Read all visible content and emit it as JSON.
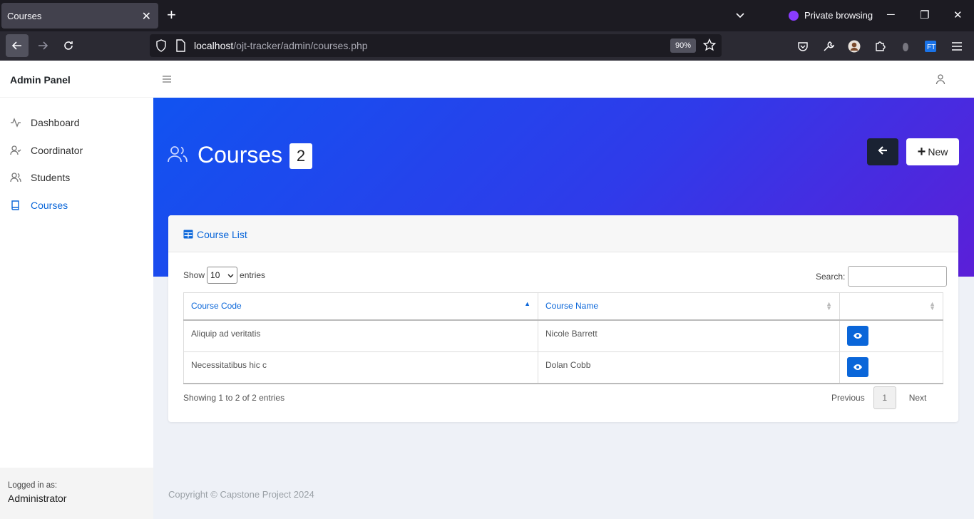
{
  "browser": {
    "tab_title": "Courses",
    "private_label": "Private browsing",
    "url_host": "localhost",
    "url_path": "/ojt-tracker/admin/courses.php",
    "zoom": "90%"
  },
  "sidebar": {
    "brand": "Admin Panel",
    "items": [
      {
        "label": "Dashboard",
        "icon": "activity-icon"
      },
      {
        "label": "Coordinator",
        "icon": "user-check-icon"
      },
      {
        "label": "Students",
        "icon": "users-icon"
      },
      {
        "label": "Courses",
        "icon": "book-icon",
        "active": true
      }
    ],
    "footer": {
      "logged_in_label": "Logged in as:",
      "user": "Administrator"
    }
  },
  "header": {
    "title": "Courses",
    "count": "2",
    "new_label": "New"
  },
  "card": {
    "title": "Course List",
    "show_label": "Show",
    "entries_value": "10",
    "entries_label": "entries",
    "search_label": "Search:",
    "columns": [
      "Course Code",
      "Course Name",
      ""
    ],
    "rows": [
      {
        "code": "Aliquip ad veritatis",
        "name": "Nicole Barrett"
      },
      {
        "code": "Necessitatibus hic c",
        "name": "Dolan Cobb"
      }
    ],
    "info": "Showing 1 to 2 of 2 entries",
    "pager": {
      "prev": "Previous",
      "current": "1",
      "next": "Next"
    }
  },
  "footer": {
    "copyright": "Copyright © Capstone Project 2024"
  },
  "colors": {
    "accent": "#0a66d9",
    "hero_start": "#1153f0",
    "hero_end": "#5b1fd8",
    "dark_button": "#1a2233"
  }
}
